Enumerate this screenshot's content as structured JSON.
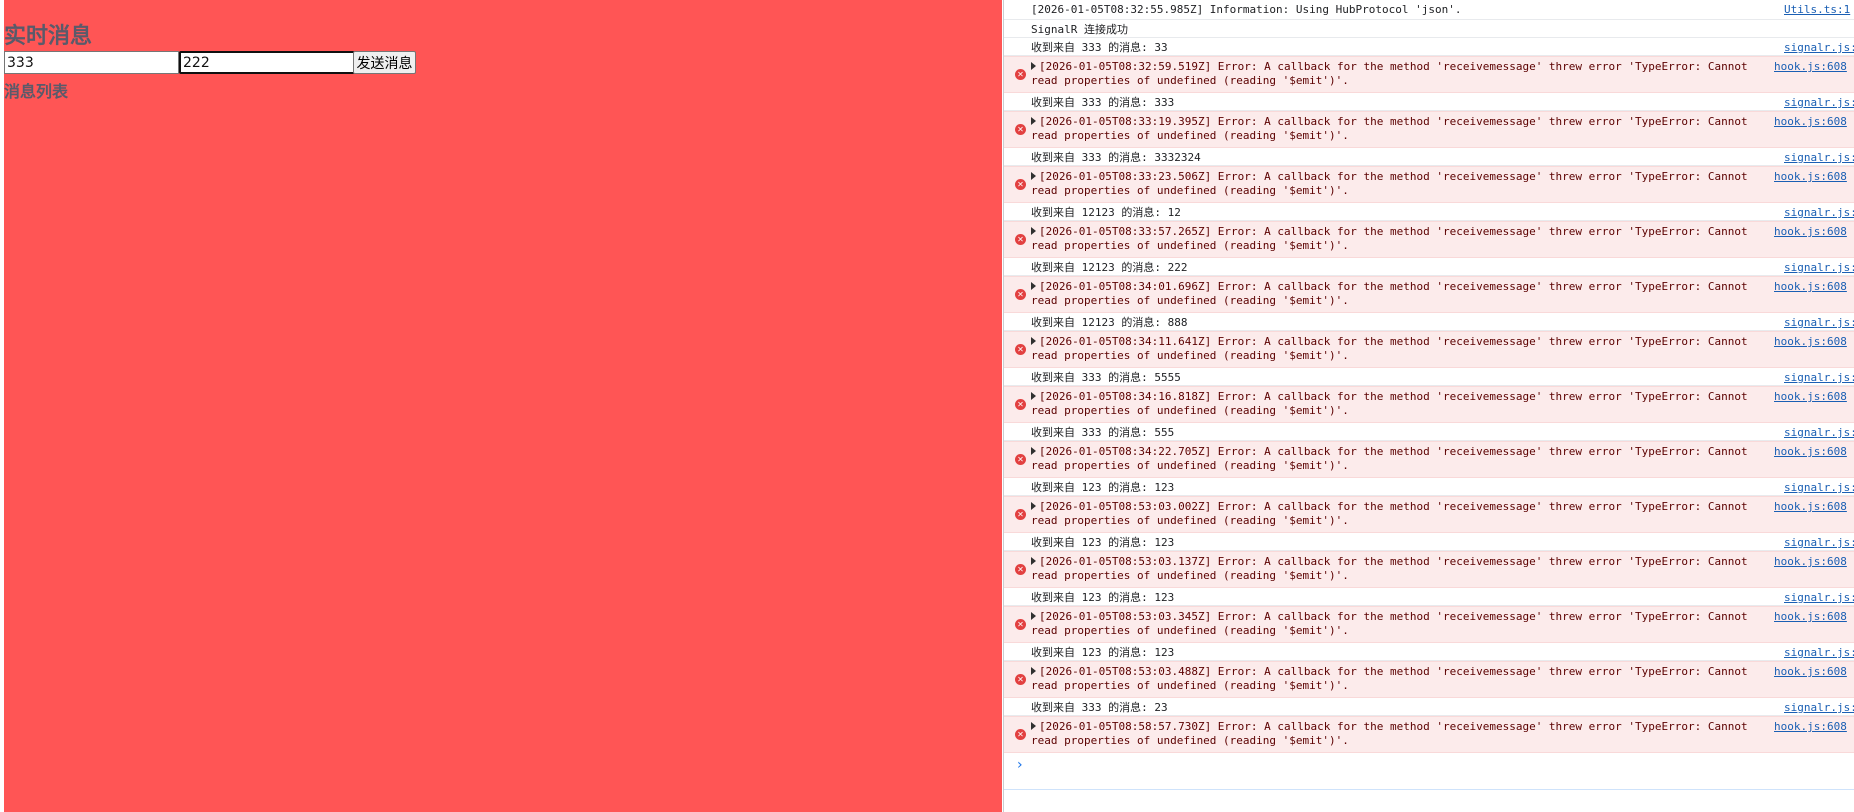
{
  "page": {
    "title": "实时消息",
    "sender_value": "333",
    "message_value": "222",
    "send_label": "发送消息",
    "list_heading": "消息列表"
  },
  "colors": {
    "page_background": "#ff5555",
    "heading": "#5a5a6a",
    "error_background": "#fcebeb",
    "error_text": "#5c0000",
    "link": "#1a5fb4",
    "error_icon": "#e24040"
  },
  "console": {
    "prompt_symbol": "›",
    "entries": [
      {
        "kind": "log",
        "text": "[2026-01-05T08:32:55.985Z] Information: Using HubProtocol 'json'.",
        "source": "Utils.ts:1"
      },
      {
        "kind": "log",
        "text": "SignalR 连接成功",
        "source": ""
      },
      {
        "kind": "log",
        "text": "收到来自 333 的消息: 33",
        "source": "signalr.js:"
      },
      {
        "kind": "error",
        "text": "[2026-01-05T08:32:59.519Z] Error: A callback for the method 'receivemessage' threw error 'TypeError: Cannot read properties of undefined (reading '$emit')'.",
        "source": "hook.js:608"
      },
      {
        "kind": "log",
        "text": "收到来自 333 的消息: 333",
        "source": "signalr.js:"
      },
      {
        "kind": "error",
        "text": "[2026-01-05T08:33:19.395Z] Error: A callback for the method 'receivemessage' threw error 'TypeError: Cannot read properties of undefined (reading '$emit')'.",
        "source": "hook.js:608"
      },
      {
        "kind": "log",
        "text": "收到来自 333 的消息: 3332324",
        "source": "signalr.js:"
      },
      {
        "kind": "error",
        "text": "[2026-01-05T08:33:23.506Z] Error: A callback for the method 'receivemessage' threw error 'TypeError: Cannot read properties of undefined (reading '$emit')'.",
        "source": "hook.js:608"
      },
      {
        "kind": "log",
        "text": "收到来自 12123 的消息: 12",
        "source": "signalr.js:"
      },
      {
        "kind": "error",
        "text": "[2026-01-05T08:33:57.265Z] Error: A callback for the method 'receivemessage' threw error 'TypeError: Cannot read properties of undefined (reading '$emit')'.",
        "source": "hook.js:608"
      },
      {
        "kind": "log",
        "text": "收到来自 12123 的消息: 222",
        "source": "signalr.js:"
      },
      {
        "kind": "error",
        "text": "[2026-01-05T08:34:01.696Z] Error: A callback for the method 'receivemessage' threw error 'TypeError: Cannot read properties of undefined (reading '$emit')'.",
        "source": "hook.js:608"
      },
      {
        "kind": "log",
        "text": "收到来自 12123 的消息: 888",
        "source": "signalr.js:"
      },
      {
        "kind": "error",
        "text": "[2026-01-05T08:34:11.641Z] Error: A callback for the method 'receivemessage' threw error 'TypeError: Cannot read properties of undefined (reading '$emit')'.",
        "source": "hook.js:608"
      },
      {
        "kind": "log",
        "text": "收到来自 333 的消息: 5555",
        "source": "signalr.js:"
      },
      {
        "kind": "error",
        "text": "[2026-01-05T08:34:16.818Z] Error: A callback for the method 'receivemessage' threw error 'TypeError: Cannot read properties of undefined (reading '$emit')'.",
        "source": "hook.js:608"
      },
      {
        "kind": "log",
        "text": "收到来自 333 的消息: 555",
        "source": "signalr.js:"
      },
      {
        "kind": "error",
        "text": "[2026-01-05T08:34:22.705Z] Error: A callback for the method 'receivemessage' threw error 'TypeError: Cannot read properties of undefined (reading '$emit')'.",
        "source": "hook.js:608"
      },
      {
        "kind": "log",
        "text": "收到来自 123 的消息: 123",
        "source": "signalr.js:"
      },
      {
        "kind": "error",
        "text": "[2026-01-05T08:53:03.002Z] Error: A callback for the method 'receivemessage' threw error 'TypeError: Cannot read properties of undefined (reading '$emit')'.",
        "source": "hook.js:608"
      },
      {
        "kind": "log",
        "text": "收到来自 123 的消息: 123",
        "source": "signalr.js:"
      },
      {
        "kind": "error",
        "text": "[2026-01-05T08:53:03.137Z] Error: A callback for the method 'receivemessage' threw error 'TypeError: Cannot read properties of undefined (reading '$emit')'.",
        "source": "hook.js:608"
      },
      {
        "kind": "log",
        "text": "收到来自 123 的消息: 123",
        "source": "signalr.js:"
      },
      {
        "kind": "error",
        "text": "[2026-01-05T08:53:03.345Z] Error: A callback for the method 'receivemessage' threw error 'TypeError: Cannot read properties of undefined (reading '$emit')'.",
        "source": "hook.js:608"
      },
      {
        "kind": "log",
        "text": "收到来自 123 的消息: 123",
        "source": "signalr.js:"
      },
      {
        "kind": "error",
        "text": "[2026-01-05T08:53:03.488Z] Error: A callback for the method 'receivemessage' threw error 'TypeError: Cannot read properties of undefined (reading '$emit')'.",
        "source": "hook.js:608"
      },
      {
        "kind": "log",
        "text": "收到来自 333 的消息: 23",
        "source": "signalr.js:"
      },
      {
        "kind": "error",
        "text": "[2026-01-05T08:58:57.730Z] Error: A callback for the method 'receivemessage' threw error 'TypeError: Cannot read properties of undefined (reading '$emit')'.",
        "source": "hook.js:608"
      }
    ]
  }
}
